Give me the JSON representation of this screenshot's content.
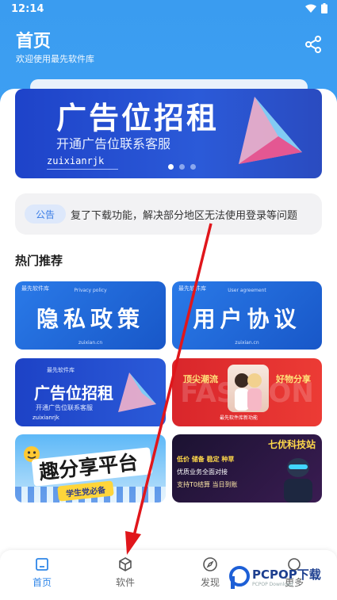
{
  "status_bar": {
    "time": "12:14"
  },
  "header": {
    "title": "首页",
    "subtitle": "欢迎使用最先软件库"
  },
  "banner": {
    "headline": "广告位招租",
    "subline": "开通广告位联系客服",
    "brand": "zuixianrjk",
    "active_slide": 0,
    "slide_count": 3
  },
  "notice": {
    "badge": "公告",
    "text": "复了下载功能，解决部分地区无法使用登录等问题"
  },
  "hot": {
    "title": "热门推荐",
    "tiles": [
      {
        "title": "隐私政策",
        "top_label": "最先软件库",
        "mid_label": "Privacy policy",
        "bottom_label": "zuixian.cn"
      },
      {
        "title": "用户协议",
        "top_label": "最先软件库",
        "mid_label": "User agreement",
        "bottom_label": "zuixian.cn"
      },
      {
        "title": "广告位招租",
        "top_label": "最先软件库",
        "mid_label": "开通广告位联系客服",
        "bottom_label": "zuixianrjk"
      },
      {
        "title_left": "顶尖潮流",
        "title_right": "好物分享",
        "bg_word": "FASHION",
        "caption": "最先软件库新功能"
      },
      {
        "title": "趣分享平台",
        "ribbon": "学生党必备"
      },
      {
        "title": "七优科技站",
        "line1": "低价 储备 稳定 种草",
        "line2": "优质业务全面对接",
        "line3": "支持T0结算 当日到账"
      }
    ]
  },
  "tabbar": {
    "tabs": [
      {
        "label": "首页",
        "active": true
      },
      {
        "label": "软件",
        "active": false
      },
      {
        "label": "发现",
        "active": false
      },
      {
        "label": "更多",
        "active": false
      }
    ]
  },
  "watermark": {
    "text": "PCPOP下载",
    "sub": "PCPOP Download"
  },
  "colors": {
    "primary": "#3a9cf0",
    "accent": "#2f86e8",
    "arrow": "#e0161b"
  }
}
